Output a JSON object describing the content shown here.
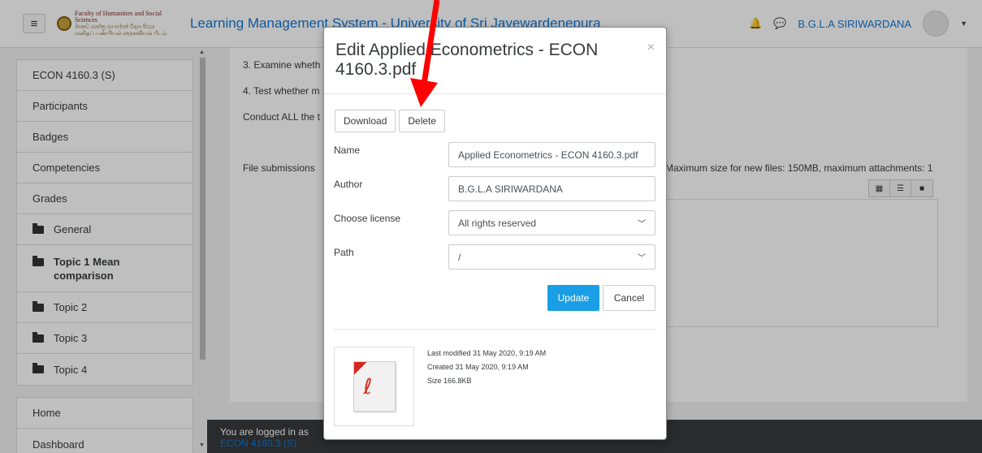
{
  "header": {
    "menu_icon": "hamburger-icon",
    "logo_line1": "Faculty of Humanities and Social Sciences",
    "logo_line2": "මානව ශාස්ත්‍ර හා සමාජ විද්‍යා පීඨය",
    "logo_line3": "மனிதப் பண்பியல் சமூகவியல் பீடம்",
    "site_title": "Learning Management System - University of Sri Jayewardenepura",
    "user_name": "B.G.L.A SIRIWARDANA"
  },
  "sidebar": {
    "items": [
      {
        "label": "ECON 4160.3 (S)"
      },
      {
        "label": "Participants"
      },
      {
        "label": "Badges"
      },
      {
        "label": "Competencies"
      },
      {
        "label": "Grades"
      }
    ],
    "sections": [
      {
        "label": "General"
      },
      {
        "label": "Topic 1 Mean comparison"
      },
      {
        "label": "Topic 2"
      },
      {
        "label": "Topic 3"
      },
      {
        "label": "Topic 4"
      }
    ],
    "bottom": [
      {
        "label": "Home"
      },
      {
        "label": "Dashboard"
      }
    ]
  },
  "content": {
    "line3": "3. Examine wheth",
    "line4": "4. Test whether m",
    "line5": "Conduct ALL the t",
    "file_submissions_label": "File submissions",
    "file_info": "Maximum size for new files: 150MB, maximum attachments: 1"
  },
  "footer": {
    "logged_in_prefix": "You are logged in as",
    "course_link": "ECON 4160.3 (S)"
  },
  "modal": {
    "title": "Edit Applied Econometrics - ECON 4160.3.pdf",
    "close": "×",
    "download_label": "Download",
    "delete_label": "Delete",
    "name_label": "Name",
    "name_value": "Applied Econometrics - ECON 4160.3.pdf",
    "author_label": "Author",
    "author_value": "B.G.L.A SIRIWARDANA",
    "license_label": "Choose license",
    "license_value": "All rights reserved",
    "path_label": "Path",
    "path_value": "/",
    "update_label": "Update",
    "cancel_label": "Cancel",
    "last_modified": "Last modified 31 May 2020, 9:19 AM",
    "created": "Created 31 May 2020, 9:19 AM",
    "size": "Size 166.8KB"
  },
  "colors": {
    "accent": "#1177d1",
    "update_button": "#1a9ee6",
    "arrow": "#ff0000"
  }
}
